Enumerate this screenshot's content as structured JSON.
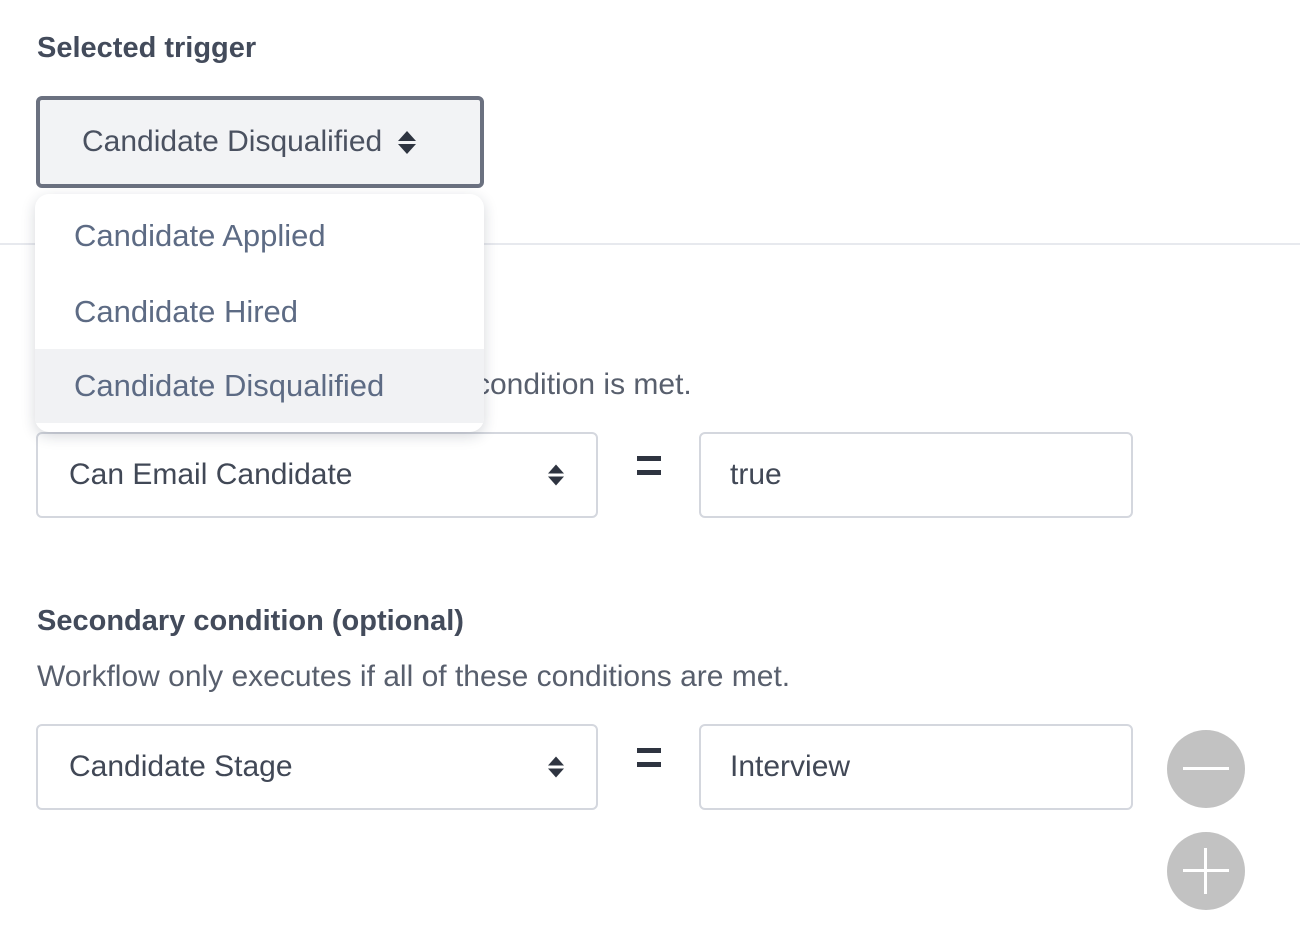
{
  "trigger": {
    "heading": "Selected trigger",
    "selected_value": "Candidate Disqualified",
    "options": [
      {
        "label": "Candidate Applied",
        "selected": false
      },
      {
        "label": "Candidate Hired",
        "selected": false
      },
      {
        "label": "Candidate Disqualified",
        "selected": true
      }
    ]
  },
  "primary_condition": {
    "description_visible": "condition is met.",
    "field": "Can Email Candidate",
    "operator": "=",
    "value": "true"
  },
  "secondary_condition": {
    "heading": "Secondary condition (optional)",
    "description": "Workflow only executes if all of these conditions are met.",
    "field": "Candidate Stage",
    "operator": "=",
    "value": "Interview"
  },
  "icons": {
    "remove": "minus-circle-icon",
    "add": "plus-circle-icon",
    "select_caret": "sort-caret-icon"
  },
  "colors": {
    "text_dark": "#434b5b",
    "dropdown_text": "#5d6b84",
    "border": "#d4d7de",
    "round_button": "#c2c2c2"
  }
}
